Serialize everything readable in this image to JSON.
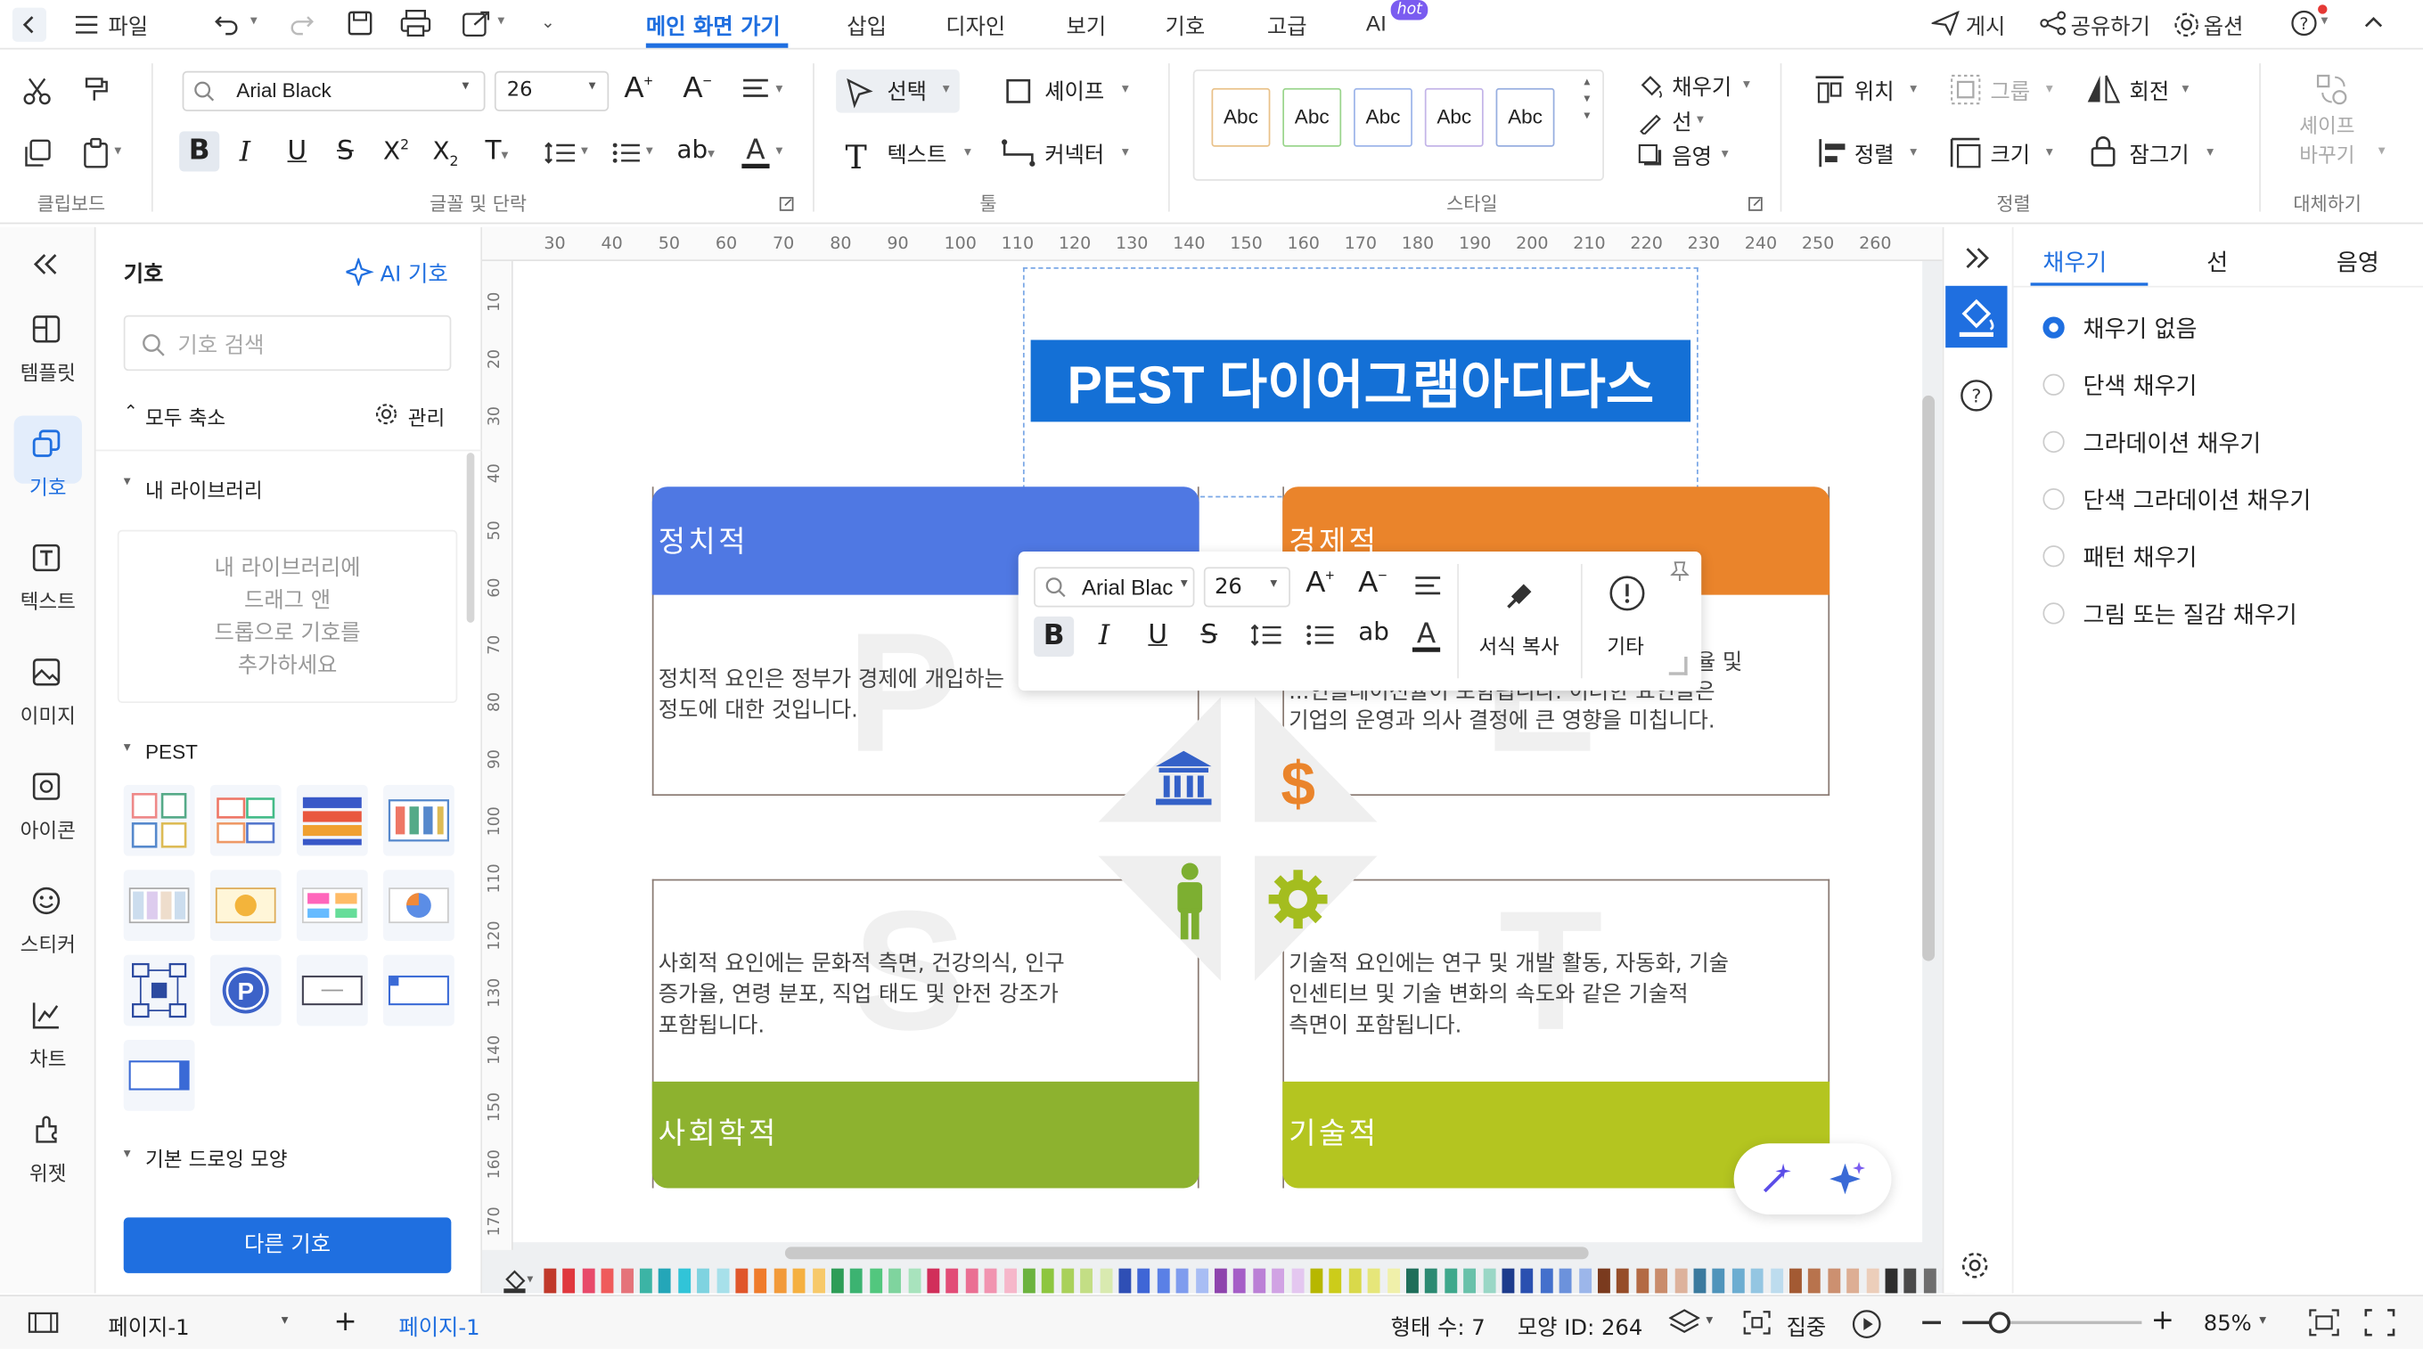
{
  "menubar": {
    "file_label": "파일",
    "tabs": [
      {
        "label": "메인 화면 가기"
      },
      {
        "label": "삽입"
      },
      {
        "label": "디자인"
      },
      {
        "label": "보기"
      },
      {
        "label": "기호"
      },
      {
        "label": "고급"
      },
      {
        "label": "AI"
      }
    ],
    "ai_badge": "hot",
    "publish_label": "게시",
    "share_label": "공유하기",
    "options_label": "옵션"
  },
  "ribbon": {
    "clipboard_label": "클립보드",
    "font_label": "글꼴 및 단락",
    "tools_label": "툴",
    "style_label": "스타일",
    "arrange_label": "정렬",
    "replace_label": "대체하기",
    "font_name": "Arial Black",
    "font_size": "26",
    "select_label": "선택",
    "shape_label": "셰이프",
    "text_label": "텍스트",
    "connector_label": "커넥터",
    "style_samples": [
      "Abc",
      "Abc",
      "Abc",
      "Abc",
      "Abc"
    ],
    "fill_label": "채우기",
    "line_label": "선",
    "shadow_label": "음영",
    "position_label": "위치",
    "group_label": "그룹",
    "rotate_label": "회전",
    "align_label": "정렬",
    "size_label": "크기",
    "lock_label": "잠그기",
    "replace_shape_label_1": "셰이프",
    "replace_shape_label_2": "바꾸기"
  },
  "leftnav": {
    "items": [
      {
        "label": "템플릿"
      },
      {
        "label": "기호"
      },
      {
        "label": "텍스트"
      },
      {
        "label": "이미지"
      },
      {
        "label": "아이콘"
      },
      {
        "label": "스티커"
      },
      {
        "label": "차트"
      },
      {
        "label": "위젯"
      }
    ]
  },
  "library": {
    "title": "기호",
    "ai_symbol": "AI 기호",
    "search_placeholder": "기호 검색",
    "collapse_all": "모두 축소",
    "manage": "관리",
    "my_library": "내 라이브러리",
    "my_library_hint": [
      "내 라이브러리에",
      "드래그 앤",
      "드롭으로 기호를",
      "추가하세요"
    ],
    "pest_section": "PEST",
    "basic_section": "기본 드로잉 모양",
    "more_button": "다른 기호"
  },
  "ruler": {
    "h_ticks": [
      "30",
      "40",
      "50",
      "60",
      "70",
      "80",
      "90",
      "100",
      "110",
      "120",
      "130",
      "140",
      "150",
      "160",
      "170",
      "180",
      "190",
      "200",
      "210",
      "220",
      "230",
      "240",
      "250",
      "260"
    ],
    "v_ticks": [
      "10",
      "20",
      "30",
      "40",
      "50",
      "60",
      "70",
      "80",
      "90",
      "100",
      "110",
      "120",
      "130",
      "140",
      "150",
      "160",
      "170"
    ]
  },
  "diagram": {
    "title": "PEST 다이어그램아디다스",
    "quadrants": [
      {
        "title": "정치적",
        "letter": "P",
        "color": "#4f78e3",
        "body": [
          "정치적 요인은 정부가 경제에 개입하는",
          "정도에 대한 것입니다."
        ]
      },
      {
        "title": "경제적",
        "letter": "E",
        "color": "#ea842b",
        "body": [
          "...율 및",
          "...인플레이션율이 포함됩니다. 이러한 요인들은",
          "기업의 운영과 의사 결정에 큰 영향을 미칩니다."
        ]
      },
      {
        "title": "사회학적",
        "letter": "S",
        "color": "#8db22f",
        "body": [
          "사회적 요인에는 문화적 측면, 건강의식, 인구",
          "증가율, 연령 분포, 직업 태도 및 안전 강조가",
          "포함됩니다."
        ]
      },
      {
        "title": "기술적",
        "letter": "T",
        "color": "#b4c520",
        "body": [
          "기술적 요인에는 연구 및 개발 활동, 자동화, 기술",
          "인센티브 및 기술 변화의 속도와 같은 기술적",
          "측면이 포함됩니다."
        ]
      }
    ]
  },
  "floating_toolbar": {
    "font_name": "Arial Blac",
    "font_size": "26",
    "format_copy": "서식 복사",
    "more": "기타"
  },
  "rightpanel": {
    "tabs": [
      {
        "label": "채우기"
      },
      {
        "label": "선"
      },
      {
        "label": "음영"
      }
    ],
    "options": [
      {
        "label": "채우기 없음",
        "selected": true
      },
      {
        "label": "단색 채우기",
        "selected": false
      },
      {
        "label": "그라데이션 채우기",
        "selected": false
      },
      {
        "label": "단색 그라데이션 채우기",
        "selected": false
      },
      {
        "label": "패턴 채우기",
        "selected": false
      },
      {
        "label": "그림 또는 질감 채우기",
        "selected": false
      }
    ]
  },
  "statusbar": {
    "page_select": "페이지-1",
    "page_tab": "페이지-1",
    "shape_count": "형태 수: 7",
    "shape_id": "모양 ID: 264",
    "focus": "집중",
    "zoom": "85%"
  },
  "colors": {
    "accent": "#1f6fe0",
    "title_bg": "#1470d6",
    "palette": [
      "#c0392b",
      "#e0383e",
      "#e84a6a",
      "#ef5b5b",
      "#e5737a",
      "#3cb4a5",
      "#24a6b8",
      "#31c4d8",
      "#7fd3e0",
      "#a7e0ea",
      "#e0562b",
      "#ef7b2b",
      "#f29a3a",
      "#f5b041",
      "#f7c96a",
      "#2e9d57",
      "#3cb371",
      "#52c77e",
      "#7fd49e",
      "#a8e3bd",
      "#d12f5a",
      "#e24c77",
      "#ea6f93",
      "#f194b0",
      "#f6b7ca",
      "#6cb33f",
      "#8dc63f",
      "#a9d15a",
      "#c3de85",
      "#d9eab0",
      "#2f4fb5",
      "#3f66d6",
      "#5a80e6",
      "#7f9cee",
      "#a8bdf4",
      "#8e44ad",
      "#a55ec7",
      "#bb80d6",
      "#d1a3e4",
      "#e4c7f0",
      "#b7b700",
      "#cccc1a",
      "#d9d94a",
      "#e6e67a",
      "#f0f0aa",
      "#1f6e5a",
      "#2c8a72",
      "#3fa88c",
      "#69c1aa",
      "#9ad7c6",
      "#1d3c8c",
      "#2a50b0",
      "#4470cc",
      "#6c92dc",
      "#9cb6ea",
      "#7a3a1e",
      "#964d29",
      "#b36a44",
      "#c98c6c",
      "#ddb29c",
      "#3b7a9e",
      "#4f94bb",
      "#6cadd1",
      "#94c6e2",
      "#bddcee",
      "#a35a33",
      "#b8734d",
      "#cc9070",
      "#ddae94",
      "#ecceba",
      "#2e2e2e",
      "#4a4a4a",
      "#6e6e6e",
      "#979797",
      "#c4c4c4",
      "#e0e0e0"
    ]
  }
}
